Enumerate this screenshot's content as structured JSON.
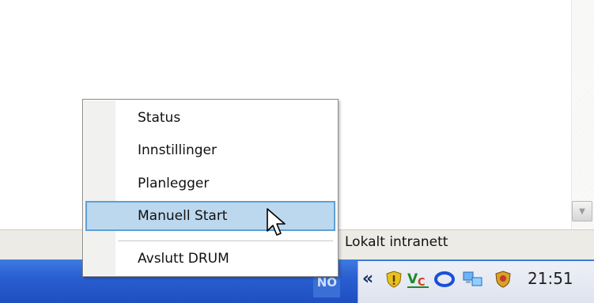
{
  "menu": {
    "items": [
      {
        "label": "Status"
      },
      {
        "label": "Innstillinger"
      },
      {
        "label": "Planlegger"
      },
      {
        "label": "Manuell Start",
        "highlighted": true
      },
      {
        "label": "Avslutt DRUM"
      }
    ]
  },
  "statusbar": {
    "zone_label": "Lokalt intranett"
  },
  "taskbar": {
    "language": "NO",
    "clock": "21:51",
    "tray_icons": [
      "expand-chevron",
      "security-shield-warning",
      "vc-icon",
      "cloud-ring-icon",
      "network-computers-icon",
      "shield-badge-icon"
    ]
  }
}
